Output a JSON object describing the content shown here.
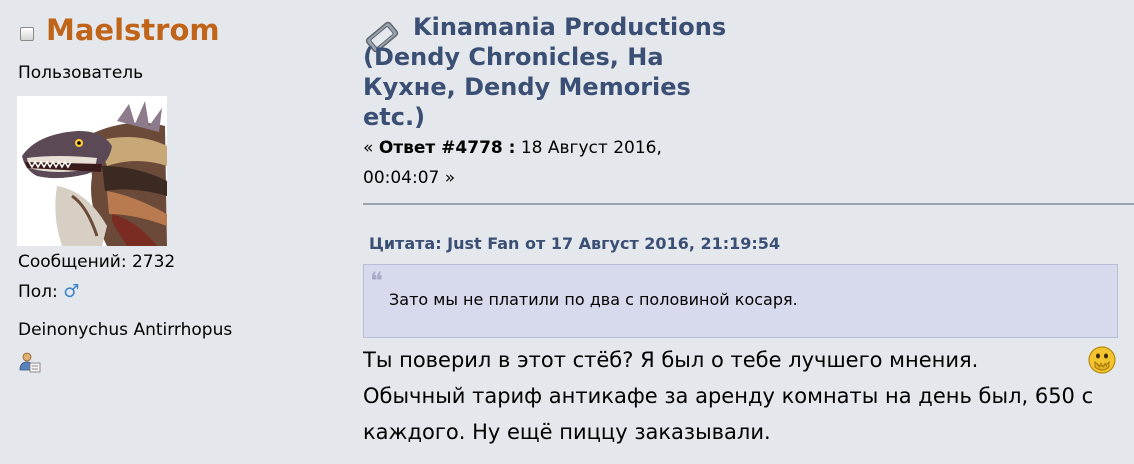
{
  "poster": {
    "username": "Maelstrom",
    "member_group": "Пользователь",
    "posts": "Сообщений: 2732",
    "gender_label": "Пол:",
    "gender_icon": "♂",
    "personal_text": "Deinonychus Antirrhopus"
  },
  "post": {
    "topic_title": "Kinamania Productions (Dendy Chronicles, На Кухне, Dendy Memories etc.)",
    "meta_prefix": "«",
    "reply_label": "Ответ #4778 :",
    "date": "18 Август 2016, 00:04:07",
    "meta_suffix": "»",
    "quote_header": "Цитата: Just Fan от 17 Август 2016, 21:19:54",
    "quote_mark": "❝",
    "quote_text": "Зато мы не платили по два с половиной косаря.",
    "body_line1": "Ты поверил в этот стёб? Я был о тебе лучшего мнения.",
    "body_line2": "Обычный тариф антикафе за аренду комнаты на день был, 650 с каждого. Ну ещё пиццу заказывали."
  },
  "colors": {
    "username": "#c06419",
    "link": "#3b4f75",
    "quote_bg": "#d7daec",
    "background": "#e4e8ec"
  }
}
